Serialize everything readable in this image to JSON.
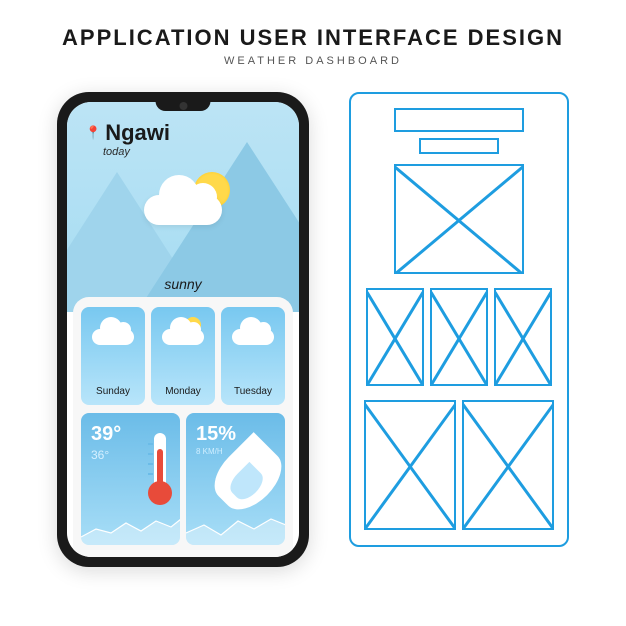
{
  "header": {
    "title": "APPLICATION USER INTERFACE DESIGN",
    "subtitle": "WEATHER DASHBOARD"
  },
  "location": {
    "city": "Ngawi",
    "when": "today",
    "condition": "sunny"
  },
  "forecast": [
    {
      "label": "Sunday"
    },
    {
      "label": "Monday"
    },
    {
      "label": "Tuesday"
    }
  ],
  "temperature": {
    "high": "39°",
    "low": "36°"
  },
  "humidity": {
    "value": "15%",
    "wind": "8 KM/H"
  }
}
